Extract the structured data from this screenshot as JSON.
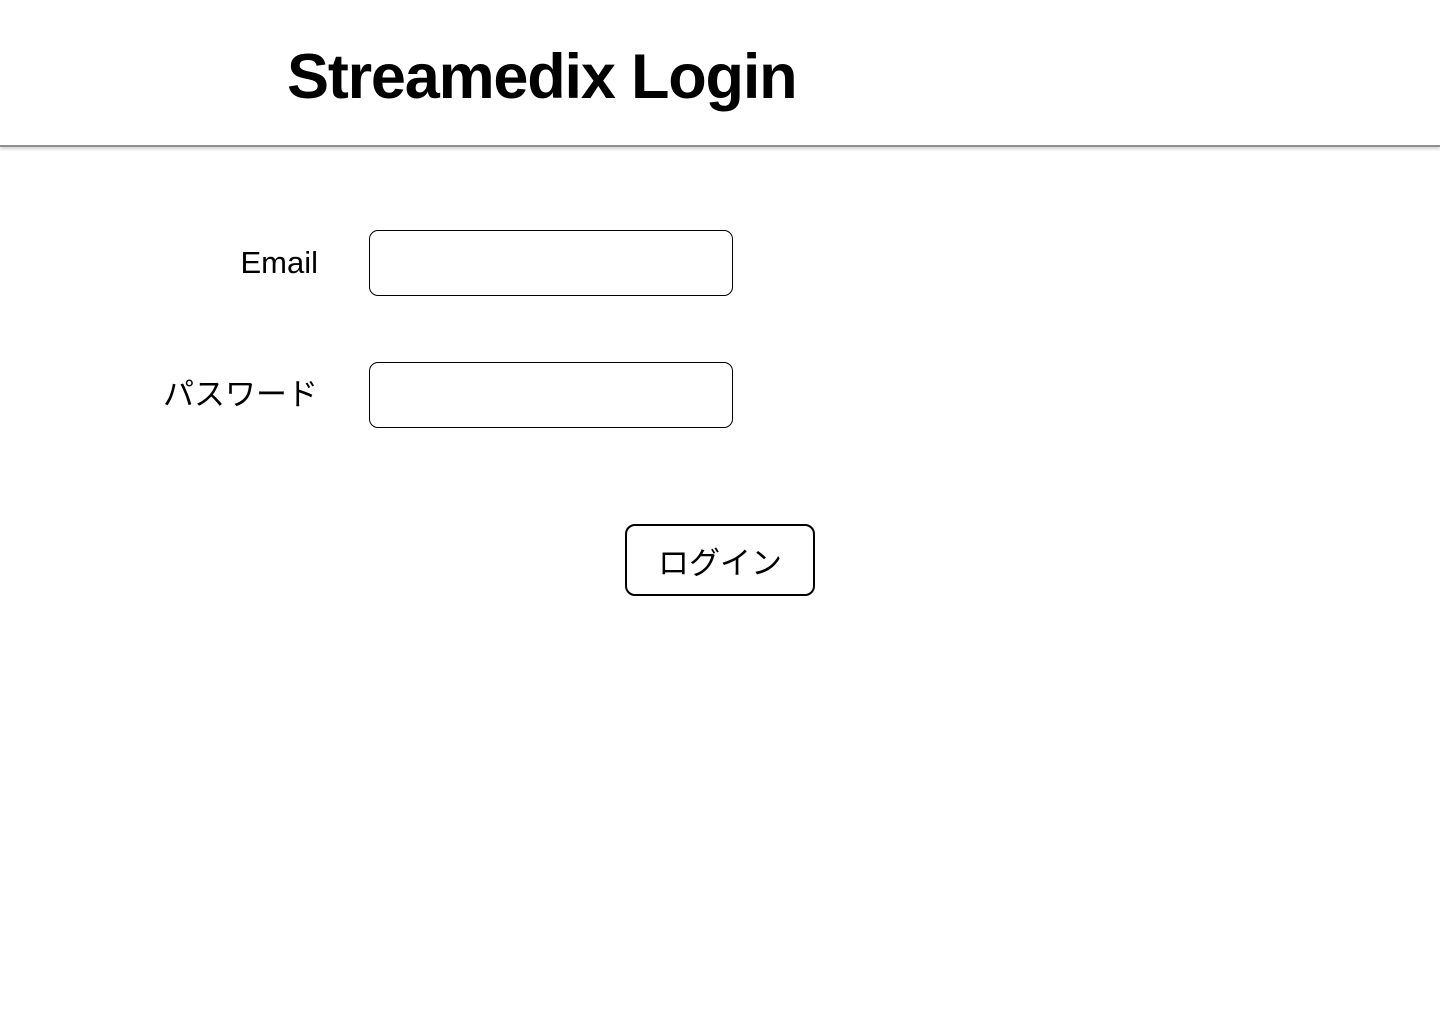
{
  "header": {
    "title": "Streamedix Login"
  },
  "form": {
    "email_label": "Email",
    "email_value": "",
    "password_label": "パスワード",
    "password_value": "",
    "submit_label": "ログイン"
  }
}
